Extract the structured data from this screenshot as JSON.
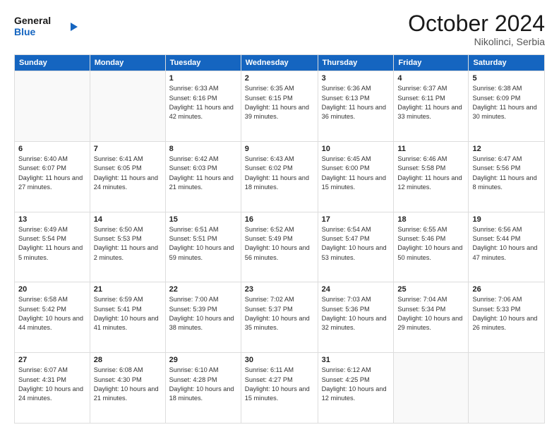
{
  "header": {
    "logo_general": "General",
    "logo_blue": "Blue",
    "month": "October 2024",
    "location": "Nikolinci, Serbia"
  },
  "weekdays": [
    "Sunday",
    "Monday",
    "Tuesday",
    "Wednesday",
    "Thursday",
    "Friday",
    "Saturday"
  ],
  "weeks": [
    [
      {
        "day": "",
        "sunrise": "",
        "sunset": "",
        "daylight": ""
      },
      {
        "day": "",
        "sunrise": "",
        "sunset": "",
        "daylight": ""
      },
      {
        "day": "1",
        "sunrise": "Sunrise: 6:33 AM",
        "sunset": "Sunset: 6:16 PM",
        "daylight": "Daylight: 11 hours and 42 minutes."
      },
      {
        "day": "2",
        "sunrise": "Sunrise: 6:35 AM",
        "sunset": "Sunset: 6:15 PM",
        "daylight": "Daylight: 11 hours and 39 minutes."
      },
      {
        "day": "3",
        "sunrise": "Sunrise: 6:36 AM",
        "sunset": "Sunset: 6:13 PM",
        "daylight": "Daylight: 11 hours and 36 minutes."
      },
      {
        "day": "4",
        "sunrise": "Sunrise: 6:37 AM",
        "sunset": "Sunset: 6:11 PM",
        "daylight": "Daylight: 11 hours and 33 minutes."
      },
      {
        "day": "5",
        "sunrise": "Sunrise: 6:38 AM",
        "sunset": "Sunset: 6:09 PM",
        "daylight": "Daylight: 11 hours and 30 minutes."
      }
    ],
    [
      {
        "day": "6",
        "sunrise": "Sunrise: 6:40 AM",
        "sunset": "Sunset: 6:07 PM",
        "daylight": "Daylight: 11 hours and 27 minutes."
      },
      {
        "day": "7",
        "sunrise": "Sunrise: 6:41 AM",
        "sunset": "Sunset: 6:05 PM",
        "daylight": "Daylight: 11 hours and 24 minutes."
      },
      {
        "day": "8",
        "sunrise": "Sunrise: 6:42 AM",
        "sunset": "Sunset: 6:03 PM",
        "daylight": "Daylight: 11 hours and 21 minutes."
      },
      {
        "day": "9",
        "sunrise": "Sunrise: 6:43 AM",
        "sunset": "Sunset: 6:02 PM",
        "daylight": "Daylight: 11 hours and 18 minutes."
      },
      {
        "day": "10",
        "sunrise": "Sunrise: 6:45 AM",
        "sunset": "Sunset: 6:00 PM",
        "daylight": "Daylight: 11 hours and 15 minutes."
      },
      {
        "day": "11",
        "sunrise": "Sunrise: 6:46 AM",
        "sunset": "Sunset: 5:58 PM",
        "daylight": "Daylight: 11 hours and 12 minutes."
      },
      {
        "day": "12",
        "sunrise": "Sunrise: 6:47 AM",
        "sunset": "Sunset: 5:56 PM",
        "daylight": "Daylight: 11 hours and 8 minutes."
      }
    ],
    [
      {
        "day": "13",
        "sunrise": "Sunrise: 6:49 AM",
        "sunset": "Sunset: 5:54 PM",
        "daylight": "Daylight: 11 hours and 5 minutes."
      },
      {
        "day": "14",
        "sunrise": "Sunrise: 6:50 AM",
        "sunset": "Sunset: 5:53 PM",
        "daylight": "Daylight: 11 hours and 2 minutes."
      },
      {
        "day": "15",
        "sunrise": "Sunrise: 6:51 AM",
        "sunset": "Sunset: 5:51 PM",
        "daylight": "Daylight: 10 hours and 59 minutes."
      },
      {
        "day": "16",
        "sunrise": "Sunrise: 6:52 AM",
        "sunset": "Sunset: 5:49 PM",
        "daylight": "Daylight: 10 hours and 56 minutes."
      },
      {
        "day": "17",
        "sunrise": "Sunrise: 6:54 AM",
        "sunset": "Sunset: 5:47 PM",
        "daylight": "Daylight: 10 hours and 53 minutes."
      },
      {
        "day": "18",
        "sunrise": "Sunrise: 6:55 AM",
        "sunset": "Sunset: 5:46 PM",
        "daylight": "Daylight: 10 hours and 50 minutes."
      },
      {
        "day": "19",
        "sunrise": "Sunrise: 6:56 AM",
        "sunset": "Sunset: 5:44 PM",
        "daylight": "Daylight: 10 hours and 47 minutes."
      }
    ],
    [
      {
        "day": "20",
        "sunrise": "Sunrise: 6:58 AM",
        "sunset": "Sunset: 5:42 PM",
        "daylight": "Daylight: 10 hours and 44 minutes."
      },
      {
        "day": "21",
        "sunrise": "Sunrise: 6:59 AM",
        "sunset": "Sunset: 5:41 PM",
        "daylight": "Daylight: 10 hours and 41 minutes."
      },
      {
        "day": "22",
        "sunrise": "Sunrise: 7:00 AM",
        "sunset": "Sunset: 5:39 PM",
        "daylight": "Daylight: 10 hours and 38 minutes."
      },
      {
        "day": "23",
        "sunrise": "Sunrise: 7:02 AM",
        "sunset": "Sunset: 5:37 PM",
        "daylight": "Daylight: 10 hours and 35 minutes."
      },
      {
        "day": "24",
        "sunrise": "Sunrise: 7:03 AM",
        "sunset": "Sunset: 5:36 PM",
        "daylight": "Daylight: 10 hours and 32 minutes."
      },
      {
        "day": "25",
        "sunrise": "Sunrise: 7:04 AM",
        "sunset": "Sunset: 5:34 PM",
        "daylight": "Daylight: 10 hours and 29 minutes."
      },
      {
        "day": "26",
        "sunrise": "Sunrise: 7:06 AM",
        "sunset": "Sunset: 5:33 PM",
        "daylight": "Daylight: 10 hours and 26 minutes."
      }
    ],
    [
      {
        "day": "27",
        "sunrise": "Sunrise: 6:07 AM",
        "sunset": "Sunset: 4:31 PM",
        "daylight": "Daylight: 10 hours and 24 minutes."
      },
      {
        "day": "28",
        "sunrise": "Sunrise: 6:08 AM",
        "sunset": "Sunset: 4:30 PM",
        "daylight": "Daylight: 10 hours and 21 minutes."
      },
      {
        "day": "29",
        "sunrise": "Sunrise: 6:10 AM",
        "sunset": "Sunset: 4:28 PM",
        "daylight": "Daylight: 10 hours and 18 minutes."
      },
      {
        "day": "30",
        "sunrise": "Sunrise: 6:11 AM",
        "sunset": "Sunset: 4:27 PM",
        "daylight": "Daylight: 10 hours and 15 minutes."
      },
      {
        "day": "31",
        "sunrise": "Sunrise: 6:12 AM",
        "sunset": "Sunset: 4:25 PM",
        "daylight": "Daylight: 10 hours and 12 minutes."
      },
      {
        "day": "",
        "sunrise": "",
        "sunset": "",
        "daylight": ""
      },
      {
        "day": "",
        "sunrise": "",
        "sunset": "",
        "daylight": ""
      }
    ]
  ]
}
